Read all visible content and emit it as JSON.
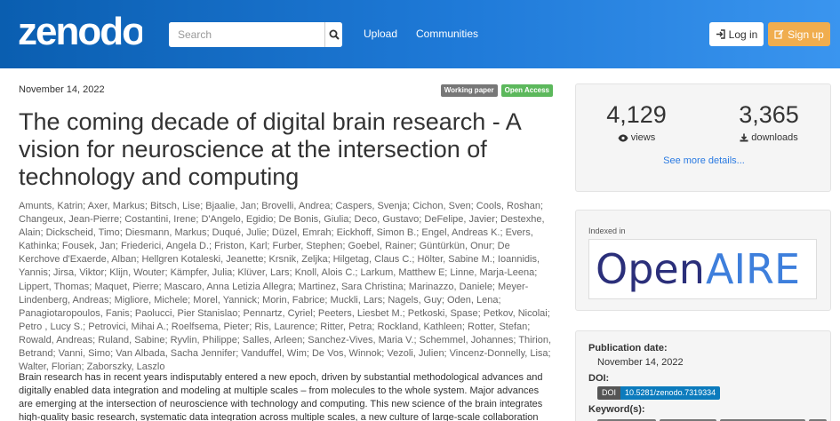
{
  "header": {
    "logo_text": "zenodo",
    "search_placeholder": "Search",
    "nav": {
      "upload": "Upload",
      "communities": "Communities"
    },
    "login_label": "Log in",
    "signup_label": "Sign up"
  },
  "record": {
    "date": "November 14, 2022",
    "badges": {
      "type": "Working paper",
      "access": "Open Access"
    },
    "title": "The coming decade of digital brain research - A vision for neuroscience at the intersection of technology and computing",
    "authors": "Amunts, Katrin; Axer, Markus; Bitsch, Lise; Bjaalie, Jan; Brovelli, Andrea; Caspers, Svenja; Cichon, Sven; Cools, Roshan; Changeux, Jean-Pierre; Costantini, Irene; D'Angelo, Egidio; De Bonis, Giulia; Deco, Gustavo; DeFelipe, Javier; Destexhe, Alain; Dickscheid, Timo; Diesmann, Markus; Duqué, Julie; Düzel, Emrah; Eickhoff, Simon B.; Engel, Andreas K.; Evers, Kathinka; Fousek, Jan; Friederici, Angela D.; Friston, Karl; Furber, Stephen; Goebel, Rainer; Güntürkün, Onur; De Kerchove d'Exaerde, Alban; Hellgren Kotaleski, Jeanette; Krsnik, Zeljka; Hilgetag, Claus C.; Hölter, Sabine M.; Ioannidis, Yannis; Jirsa, Viktor; Klijn, Wouter; Kämpfer, Julia; Klüver, Lars; Knoll, Alois C.; Larkum, Matthew E; Linne, Marja-Leena; Lippert, Thomas; Maquet, Pierre; Mascaro, Anna Letizia Allegra; Martinez, Sara Christina; Marinazzo, Daniele; Meyer-Lindenberg, Andreas; Migliore, Michele; Morel, Yannick; Morin, Fabrice; Muckli, Lars; Nagels, Guy; Oden, Lena; Panagiotaropoulos, Fanis; Paolucci, Pier Stanislao; Pennartz, Cyriel; Peeters, Liesbet M.; Petkoski, Spase; Petkov, Nicolai; Petro , Lucy S.; Petrovici, Mihai A.; Roelfsema, Pieter; Ris, Laurence; Ritter, Petra; Rockland, Kathleen; Rotter, Stefan; Rowald, Andreas; Ruland, Sabine; Ryvlin, Philippe; Salles, Arleen; Sanchez-Vives, Maria V.; Schemmel, Johannes; Thirion, Betrand; Vanni, Simo; Van Albada, Sacha Jennifer; Vanduffel, Wim; De Vos, Winnok; Vezoli, Julien; Vincenz-Donnelly, Lisa; Walter, Florian; Zaborszky, Laszlo",
    "abstract": "Brain research has in recent years indisputably entered a new epoch, driven by substantial methodological advances and digitally enabled data integration and modeling at multiple scales – from molecules to the whole system. Major advances are emerging at the intersection of neuroscience with technology and computing. This new science of the brain integrates high-quality basic research, systematic data integration across multiple scales, a new culture of large-scale collaboration"
  },
  "sidebar": {
    "views_count": "4,129",
    "views_label": "views",
    "downloads_count": "3,365",
    "downloads_label": "downloads",
    "see_more": "See more details...",
    "indexed_label": "Indexed in",
    "openaire_open": "Open",
    "openaire_aire": "AIRE",
    "pub_date_label": "Publication date:",
    "pub_date_value": "November 14, 2022",
    "doi_label": "DOI:",
    "doi_prefix": "DOI",
    "doi_value": "10.5281/zenodo.7319334",
    "keywords_label": "Keyword(s):"
  },
  "colors": {
    "header_start": "#0a5eb0",
    "header_end": "#3a95ef",
    "signup": "#f0ad4e",
    "open_access": "#5cb85c",
    "link": "#2a7ae2",
    "openaire_dark": "#2b2f7a",
    "openaire_blue": "#3e7fdc"
  }
}
